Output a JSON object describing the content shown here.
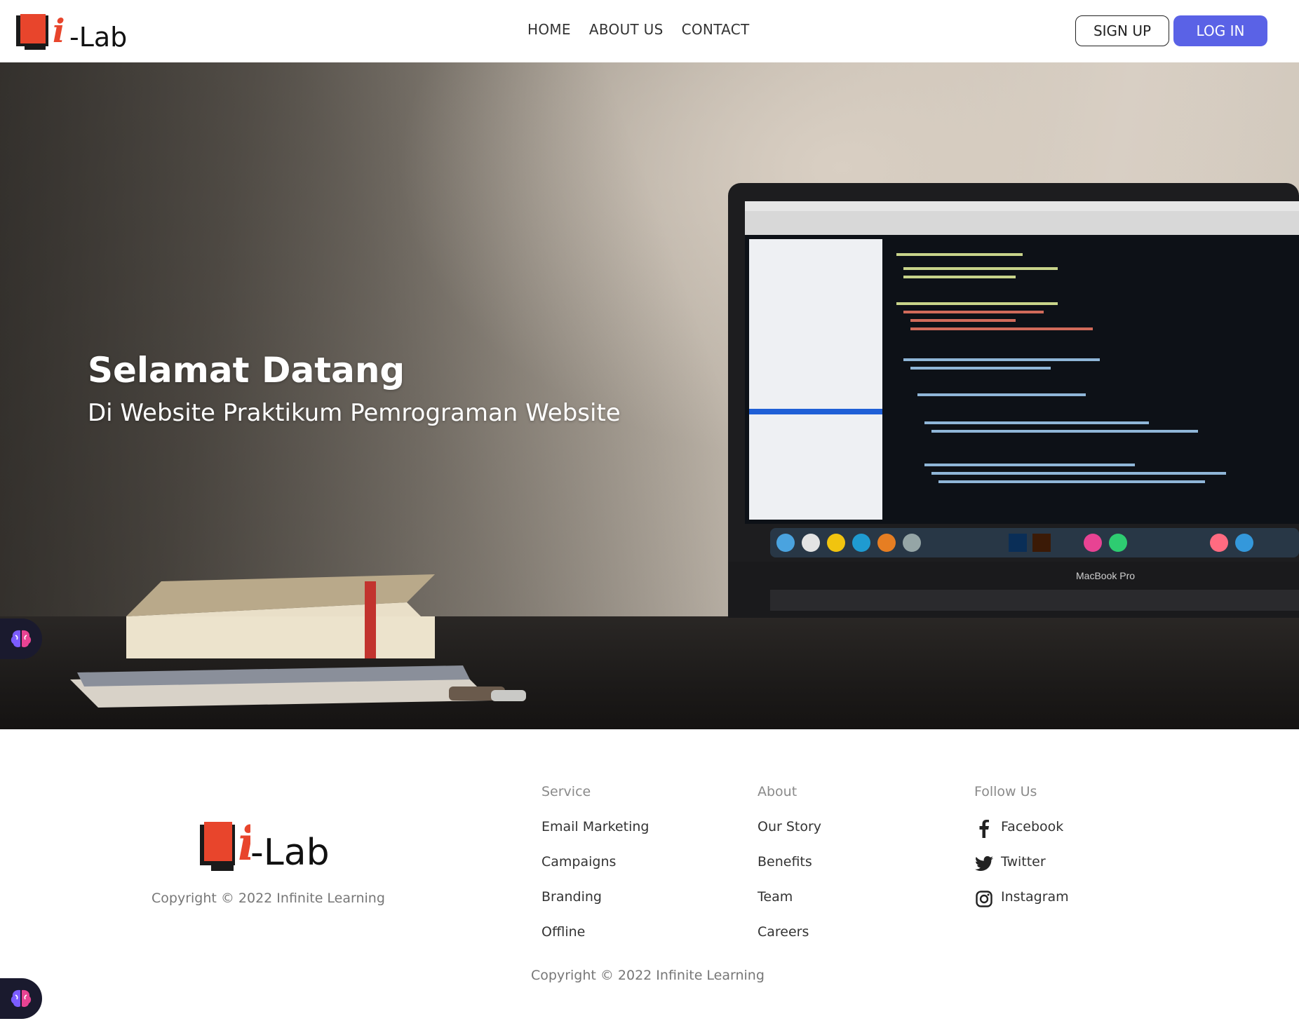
{
  "brand": {
    "name": "-Lab",
    "mark": "i"
  },
  "nav": {
    "items": [
      "HOME",
      "ABOUT US",
      "CONTACT"
    ]
  },
  "auth": {
    "signup_label": "SIGN UP",
    "login_label": "LOG IN"
  },
  "hero": {
    "title": "Selamat Datang",
    "subtitle": "Di Website Praktikum Pemrograman Website",
    "laptop_label": "MacBook Pro"
  },
  "footer": {
    "copyright": "Copyright © 2022 Infinite Learning",
    "columns": [
      {
        "title": "Service",
        "items": [
          "Email Marketing",
          "Campaigns",
          "Branding",
          "Offline"
        ]
      },
      {
        "title": "About",
        "items": [
          "Our Story",
          "Benefits",
          "Team",
          "Careers"
        ]
      },
      {
        "title": "Follow Us",
        "items": [
          {
            "label": "Facebook",
            "icon": "facebook-icon"
          },
          {
            "label": "Twitter",
            "icon": "twitter-icon"
          },
          {
            "label": "Instagram",
            "icon": "instagram-icon"
          }
        ]
      }
    ],
    "bottom_copyright": "Copyright © 2022 Infinite Learning"
  },
  "widgets": [
    {
      "icon": "brain-icon"
    },
    {
      "icon": "brain-icon"
    }
  ],
  "colors": {
    "accent": "#5a62e6",
    "logo_red": "#e8452c"
  }
}
